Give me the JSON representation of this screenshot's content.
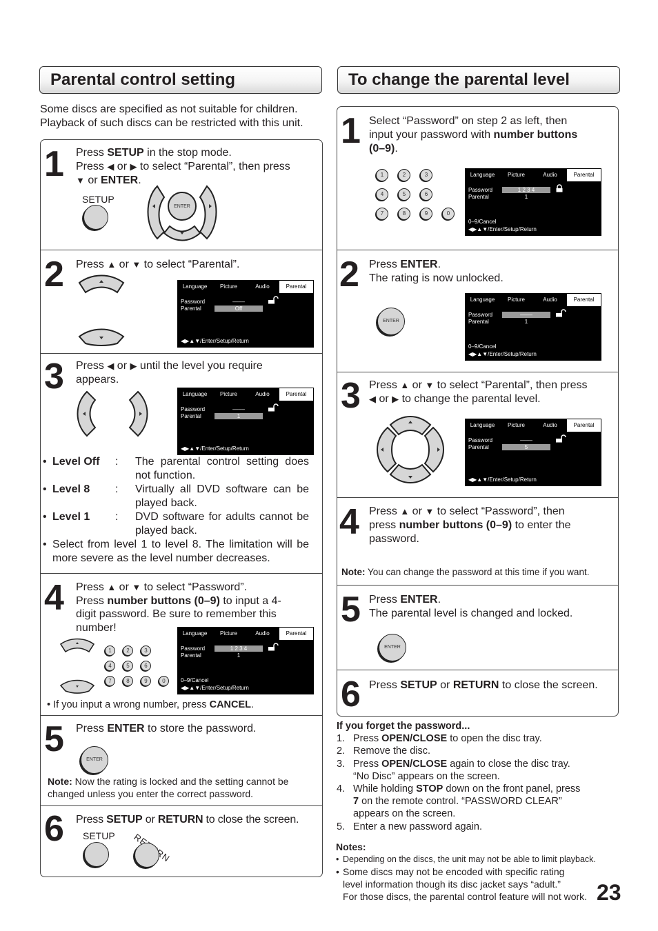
{
  "left": {
    "title": "Parental control setting",
    "intro": [
      "Some discs are specified as not suitable for children.",
      "Playback of such discs can be restricted with this unit."
    ],
    "steps": [
      {
        "num": "1",
        "lines": [
          [
            {
              "t": "Press "
            },
            {
              "b": "SETUP"
            },
            {
              "t": " in the stop mode."
            }
          ],
          [
            {
              "t": "Press "
            },
            {
              "i": "◀"
            },
            {
              "t": " or "
            },
            {
              "i": "▶"
            },
            {
              "t": " to select “Parental”, then press"
            }
          ],
          [
            {
              "i": "▼"
            },
            {
              "t": " or "
            },
            {
              "b": "ENTER"
            },
            {
              "t": "."
            }
          ]
        ],
        "setup_label": "SETUP",
        "enter_label": "ENTER"
      },
      {
        "num": "2",
        "lines": [
          [
            {
              "t": "Press "
            },
            {
              "i": "▲"
            },
            {
              "t": " or "
            },
            {
              "i": "▼"
            },
            {
              "t": " to select “Parental”."
            }
          ]
        ]
      },
      {
        "num": "3",
        "lines": [
          [
            {
              "t": "Press "
            },
            {
              "i": "◀"
            },
            {
              "t": " or "
            },
            {
              "i": "▶"
            },
            {
              "t": " until the level you require"
            }
          ],
          [
            {
              "t": "appears."
            }
          ]
        ],
        "levels": [
          {
            "name": "Level Off",
            "desc": [
              "The parental control setting does",
              "not function."
            ]
          },
          {
            "name": "Level 8",
            "desc": [
              "Virtually all DVD software can be",
              "played back."
            ]
          },
          {
            "name": "Level 1",
            "desc": [
              "DVD software for adults cannot be",
              "played back."
            ]
          }
        ],
        "bullet": [
          "Select from level 1 to level 8. The limitation will be",
          "more severe as the level number decreases."
        ]
      },
      {
        "num": "4",
        "lines": [
          [
            {
              "t": "Press "
            },
            {
              "i": "▲"
            },
            {
              "t": " or "
            },
            {
              "i": "▼"
            },
            {
              "t": " to select “Password”."
            }
          ],
          [
            {
              "t": "Press "
            },
            {
              "b": "number buttons  (0–9)"
            },
            {
              "t": " to input a 4-"
            }
          ],
          [
            {
              "t": "digit  password. Be sure to remember this"
            }
          ],
          [
            {
              "t": "number!"
            }
          ]
        ],
        "bullet": [
          {
            "t": "If you input a wrong number, press "
          },
          {
            "b": "CANCEL"
          },
          {
            "t": "."
          }
        ]
      },
      {
        "num": "5",
        "lines": [
          [
            {
              "t": "Press "
            },
            {
              "b": "ENTER"
            },
            {
              "t": " to store the password."
            }
          ]
        ],
        "enter_label": "ENTER",
        "note": [
          [
            {
              "b": "Note:"
            },
            {
              "t": " Now the rating is locked and the setting cannot be"
            }
          ],
          [
            {
              "t": "changed unless you enter the correct password."
            }
          ]
        ]
      },
      {
        "num": "6",
        "lines": [
          [
            {
              "t": "Press "
            },
            {
              "b": "SETUP"
            },
            {
              "t": " or "
            },
            {
              "b": "RETURN"
            },
            {
              "t": " to close the screen."
            }
          ]
        ],
        "setup_label": "SETUP",
        "return_label": "RETURN"
      }
    ]
  },
  "right": {
    "title": "To change the parental level",
    "steps": [
      {
        "num": "1",
        "lines": [
          [
            {
              "t": "Select “Password” on step 2 as left, then"
            }
          ],
          [
            {
              "t": "input your password with "
            },
            {
              "b": "number buttons"
            }
          ],
          [
            {
              "b": "(0–9)"
            },
            {
              "t": "."
            }
          ]
        ]
      },
      {
        "num": "2",
        "lines": [
          [
            {
              "t": "Press "
            },
            {
              "b": "ENTER"
            },
            {
              "t": "."
            }
          ],
          [
            {
              "t": "The rating is now unlocked."
            }
          ]
        ],
        "enter_label": "ENTER"
      },
      {
        "num": "3",
        "lines": [
          [
            {
              "t": "Press "
            },
            {
              "i": "▲"
            },
            {
              "t": " or "
            },
            {
              "i": "▼"
            },
            {
              "t": " to select “Parental”, then press"
            }
          ],
          [
            {
              "i": "◀"
            },
            {
              "t": " or "
            },
            {
              "i": "▶"
            },
            {
              "t": " to change the parental level."
            }
          ]
        ]
      },
      {
        "num": "4",
        "lines": [
          [
            {
              "t": "Press "
            },
            {
              "i": "▲"
            },
            {
              "t": " or "
            },
            {
              "i": "▼"
            },
            {
              "t": " to select “Password”, then"
            }
          ],
          [
            {
              "t": "press "
            },
            {
              "b": "number buttons (0–9)"
            },
            {
              "t": " to enter the"
            }
          ],
          [
            {
              "t": "password."
            }
          ]
        ],
        "note": [
          [
            {
              "b": "Note:"
            },
            {
              "t": " You can change the password at this time if you want."
            }
          ]
        ]
      },
      {
        "num": "5",
        "lines": [
          [
            {
              "t": "Press "
            },
            {
              "b": "ENTER"
            },
            {
              "t": "."
            }
          ],
          [
            {
              "t": "The parental level is changed and locked."
            }
          ]
        ],
        "enter_label": "ENTER"
      },
      {
        "num": "6",
        "lines": [
          [
            {
              "t": "Press "
            },
            {
              "b": "SETUP"
            },
            {
              "t": " or "
            },
            {
              "b": "RETURN"
            },
            {
              "t": " to close the screen."
            }
          ]
        ]
      }
    ],
    "forget": {
      "title": "If you forget the password...",
      "items": [
        {
          "n": "1.",
          "lines": [
            [
              {
                "t": "Press "
              },
              {
                "b": "OPEN/CLOSE"
              },
              {
                "t": " to open the disc tray."
              }
            ]
          ]
        },
        {
          "n": "2.",
          "lines": [
            [
              {
                "t": "Remove the disc."
              }
            ]
          ]
        },
        {
          "n": "3.",
          "lines": [
            [
              {
                "t": "Press "
              },
              {
                "b": "OPEN/CLOSE"
              },
              {
                "t": " again to close the disc tray."
              }
            ],
            [
              {
                "t": "“No Disc” appears on the screen."
              }
            ]
          ]
        },
        {
          "n": "4.",
          "lines": [
            [
              {
                "t": "While holding "
              },
              {
                "b": "STOP"
              },
              {
                "t": " down on the front panel, press"
              }
            ],
            [
              {
                "b": "7"
              },
              {
                "t": " on the remote control. “PASSWORD CLEAR”"
              }
            ],
            [
              {
                "t": "appears on the screen."
              }
            ]
          ]
        },
        {
          "n": "5.",
          "lines": [
            [
              {
                "t": "Enter a new password again."
              }
            ]
          ]
        }
      ]
    },
    "notes": {
      "title": "Notes:",
      "items": [
        [
          "Depending on the discs, the unit may not be able to limit playback."
        ],
        [
          "Some discs may not be encoded with specific rating",
          "level information though its disc jacket says “adult.”",
          "For those discs, the parental control feature will not work."
        ]
      ]
    }
  },
  "osd": {
    "tabs": [
      "Language",
      "Picture",
      "Audio",
      "Parental"
    ],
    "active_tab": "Parental",
    "password_label": "Password",
    "parental_label": "Parental",
    "hint_cancel": "0–9/Cancel",
    "hint_nav": "◀▶▲▼/Enter/Setup/Return",
    "screens": {
      "L2": {
        "password": "––––",
        "parental": "Off",
        "highlight": "parental",
        "lock": "unlocked",
        "cancel": false
      },
      "L3": {
        "password": "––––",
        "parental": "1",
        "highlight": "parental",
        "lock": "unlocked",
        "cancel": false
      },
      "L4": {
        "password": "1 2 3 4",
        "parental": "1",
        "highlight": "password",
        "lock": "unlocked",
        "cancel": true
      },
      "R1": {
        "password": "1 2 3 4",
        "parental": "1",
        "highlight": "password",
        "lock": "locked",
        "cancel": true
      },
      "R2": {
        "password": "––––",
        "parental": "1",
        "highlight": "password",
        "lock": "unlocked",
        "cancel": true
      },
      "R3": {
        "password": "––––",
        "parental": "5",
        "highlight": "parental",
        "lock": "unlocked",
        "cancel": false
      }
    }
  },
  "keypad": [
    "1",
    "2",
    "3",
    "4",
    "5",
    "6",
    "7",
    "8",
    "9",
    "0"
  ],
  "page_number": "23"
}
